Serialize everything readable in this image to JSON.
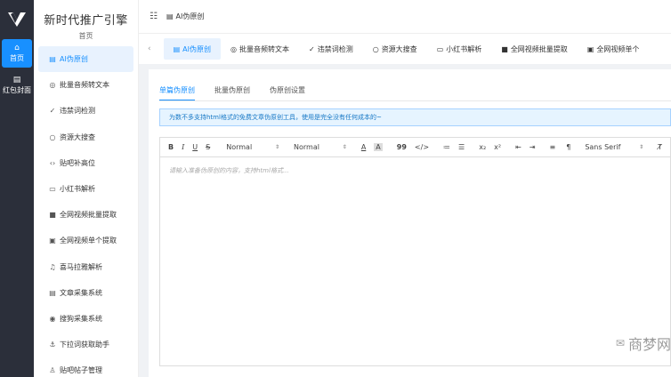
{
  "rail": {
    "items": [
      {
        "icon": "home-icon",
        "label": "首页"
      },
      {
        "icon": "red-packet-icon",
        "label": "红包封面"
      }
    ]
  },
  "brand": {
    "title": "新时代推广引擎",
    "subtitle": "首页"
  },
  "sidebar": {
    "items": [
      {
        "icon": "doc-icon",
        "label": "AI伪原创",
        "active": true
      },
      {
        "icon": "audio-icon",
        "label": "批量音频转文本"
      },
      {
        "icon": "check-icon",
        "label": "违禁词检测"
      },
      {
        "icon": "search-icon",
        "label": "资源大搜查"
      },
      {
        "icon": "code-icon",
        "label": "贴吧补高位"
      },
      {
        "icon": "book-icon",
        "label": "小红书解析"
      },
      {
        "icon": "video-icon",
        "label": "全网视频批量提取"
      },
      {
        "icon": "video-single-icon",
        "label": "全网视频单个提取"
      },
      {
        "icon": "music-icon",
        "label": "喜马拉雅解析"
      },
      {
        "icon": "article-icon",
        "label": "文章采集系统"
      },
      {
        "icon": "target-icon",
        "label": "搜狗采集系统"
      },
      {
        "icon": "anchor-icon",
        "label": "下拉词获取助手"
      },
      {
        "icon": "user-icon",
        "label": "贴吧帖子管理"
      }
    ]
  },
  "header": {
    "breadcrumb": "AI伪原创"
  },
  "tabs": [
    {
      "label": "AI伪原创",
      "active": true
    },
    {
      "label": "批量音频转文本"
    },
    {
      "label": "违禁词检测"
    },
    {
      "label": "资源大搜查"
    },
    {
      "label": "小红书解析"
    },
    {
      "label": "全网视频批量提取"
    },
    {
      "label": "全网视频单个"
    }
  ],
  "subtabs": [
    {
      "label": "单篇伪原创",
      "active": true
    },
    {
      "label": "批量伪原创"
    },
    {
      "label": "伪原创设置"
    }
  ],
  "notice": "为数不多支持html格式的免费文章伪原创工具，使用是完全没有任何成本的~",
  "toolbar": {
    "bold": "B",
    "italic": "I",
    "underline": "U",
    "strike": "S",
    "size1": "Normal",
    "size2": "Normal",
    "color": "A",
    "bg": "A",
    "quote": "99",
    "code": "</>",
    "ol": "≔",
    "ul": "☰",
    "sub": "x₂",
    "sup": "x²",
    "indent_left": "⇤",
    "indent_right": "⇥",
    "align": "≡",
    "direction": "¶",
    "font": "Sans Serif",
    "clear": "T̸"
  },
  "editor": {
    "placeholder": "请输入准备伪原创的内容，支持html格式..."
  },
  "watermark": "商梦网"
}
